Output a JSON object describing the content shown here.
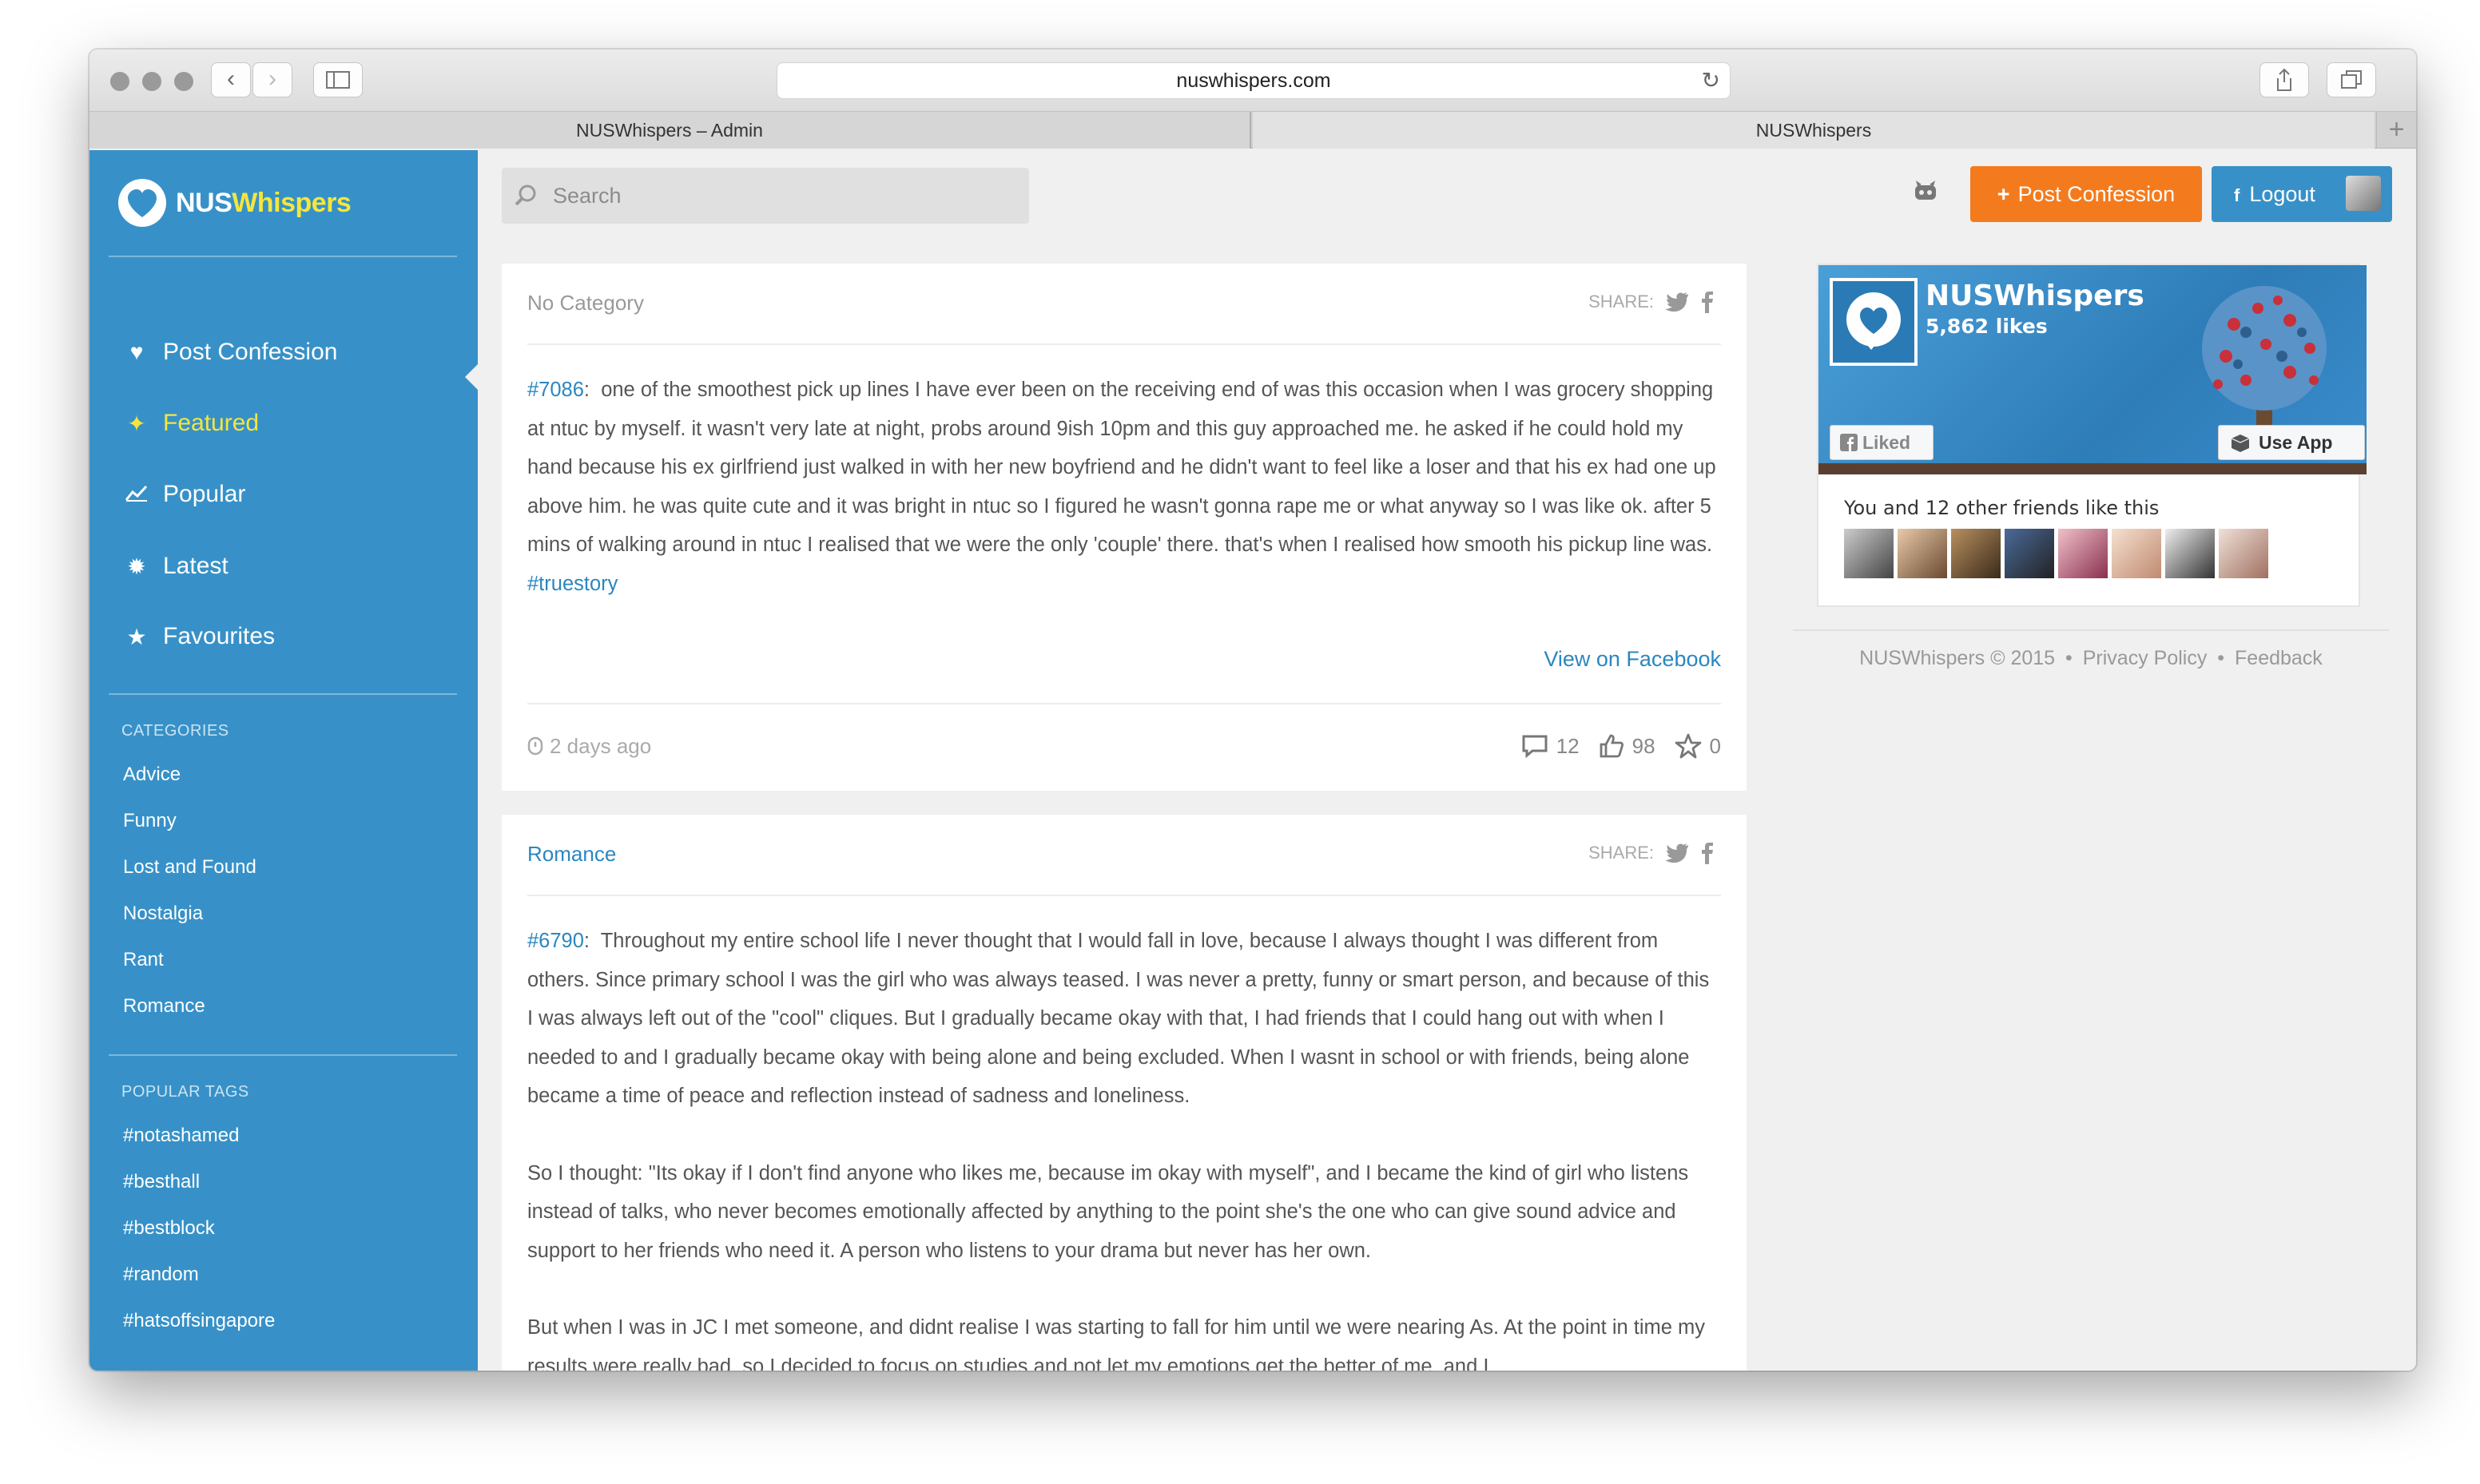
{
  "browser": {
    "url": "nuswhispers.com",
    "tabs": [
      "NUSWhispers – Admin",
      "NUSWhispers"
    ]
  },
  "brand": {
    "prefix": "NUS",
    "suffix": "Whispers",
    "accent": "#f5e63c",
    "primary": "#3791c8",
    "orange": "#f47b1d"
  },
  "nav": [
    {
      "label": "Post Confession",
      "icon": "heart-icon"
    },
    {
      "label": "Featured",
      "icon": "pin-icon"
    },
    {
      "label": "Popular",
      "icon": "trend-icon"
    },
    {
      "label": "Latest",
      "icon": "badge-icon"
    },
    {
      "label": "Favourites",
      "icon": "star-icon"
    }
  ],
  "categories": {
    "heading": "CATEGORIES",
    "items": [
      "Advice",
      "Funny",
      "Lost and Found",
      "Nostalgia",
      "Rant",
      "Romance"
    ]
  },
  "tags": {
    "heading": "POPULAR TAGS",
    "items": [
      "#notashamed",
      "#besthall",
      "#bestblock",
      "#random",
      "#hatsoffsingapore"
    ]
  },
  "header": {
    "search_placeholder": "Search",
    "post_button": "Post Confession",
    "logout_button": "Logout"
  },
  "posts": [
    {
      "category": "No Category",
      "share_label": "SHARE:",
      "id": "#7086",
      "paragraphs": [
        "one of the smoothest pick up lines I have ever been on the receiving end of was this occasion when I was grocery shopping at ntuc by myself. it wasn't very late at night, probs around 9ish 10pm and this guy approached me. he asked if he could hold my hand because his ex girlfriend just walked in with her new boyfriend and he didn't want to feel like a loser and that his ex had one up above him. he was quite cute and it was bright in ntuc so I figured he wasn't gonna rape me or what anyway so I was like ok. after 5 mins of walking around in ntuc I realised that we were the only 'couple' there. that's when I realised how smooth his pickup line was."
      ],
      "tag": "#truestory",
      "view_link": "View on Facebook",
      "time": "2 days ago",
      "comments": "12",
      "likes": "98",
      "favourites": "0"
    },
    {
      "category": "Romance",
      "share_label": "SHARE:",
      "id": "#6790",
      "paragraphs": [
        "Throughout my entire school life I never thought that I would fall in love, because I always thought I was different from others. Since primary school I was the girl who was always teased. I was never a pretty, funny or smart person, and because of this I was always left out of the \"cool\" cliques. But I gradually became okay with that, I had friends that I could hang out with when I needed to and I gradually became okay with being alone and being excluded. When I wasnt in school or with friends, being alone became a time of peace and reflection instead of sadness and loneliness.",
        "So I thought: \"Its okay if I don't find anyone who likes me, because im okay with myself\", and I became the kind of girl who listens instead of talks, who never becomes emotionally affected by anything to the point she's the one who can give sound advice and support to her friends who need it. A person who listens to your drama but never has her own.",
        "But when I was in JC I met someone, and didnt realise I was starting to fall for him until we were nearing As. At the point in time my results were really bad, so I decided to focus on studies and not let my emotions get the better of me, and I"
      ]
    }
  ],
  "facebook": {
    "page_name": "NUSWhispers",
    "likes": "5,862 likes",
    "liked_label": "Liked",
    "app_label": "Use App",
    "friends_text": "You and 12 other friends like this"
  },
  "footer": {
    "copyright": "NUSWhispers © 2015",
    "privacy": "Privacy Policy",
    "feedback": "Feedback",
    "separator": "•"
  }
}
